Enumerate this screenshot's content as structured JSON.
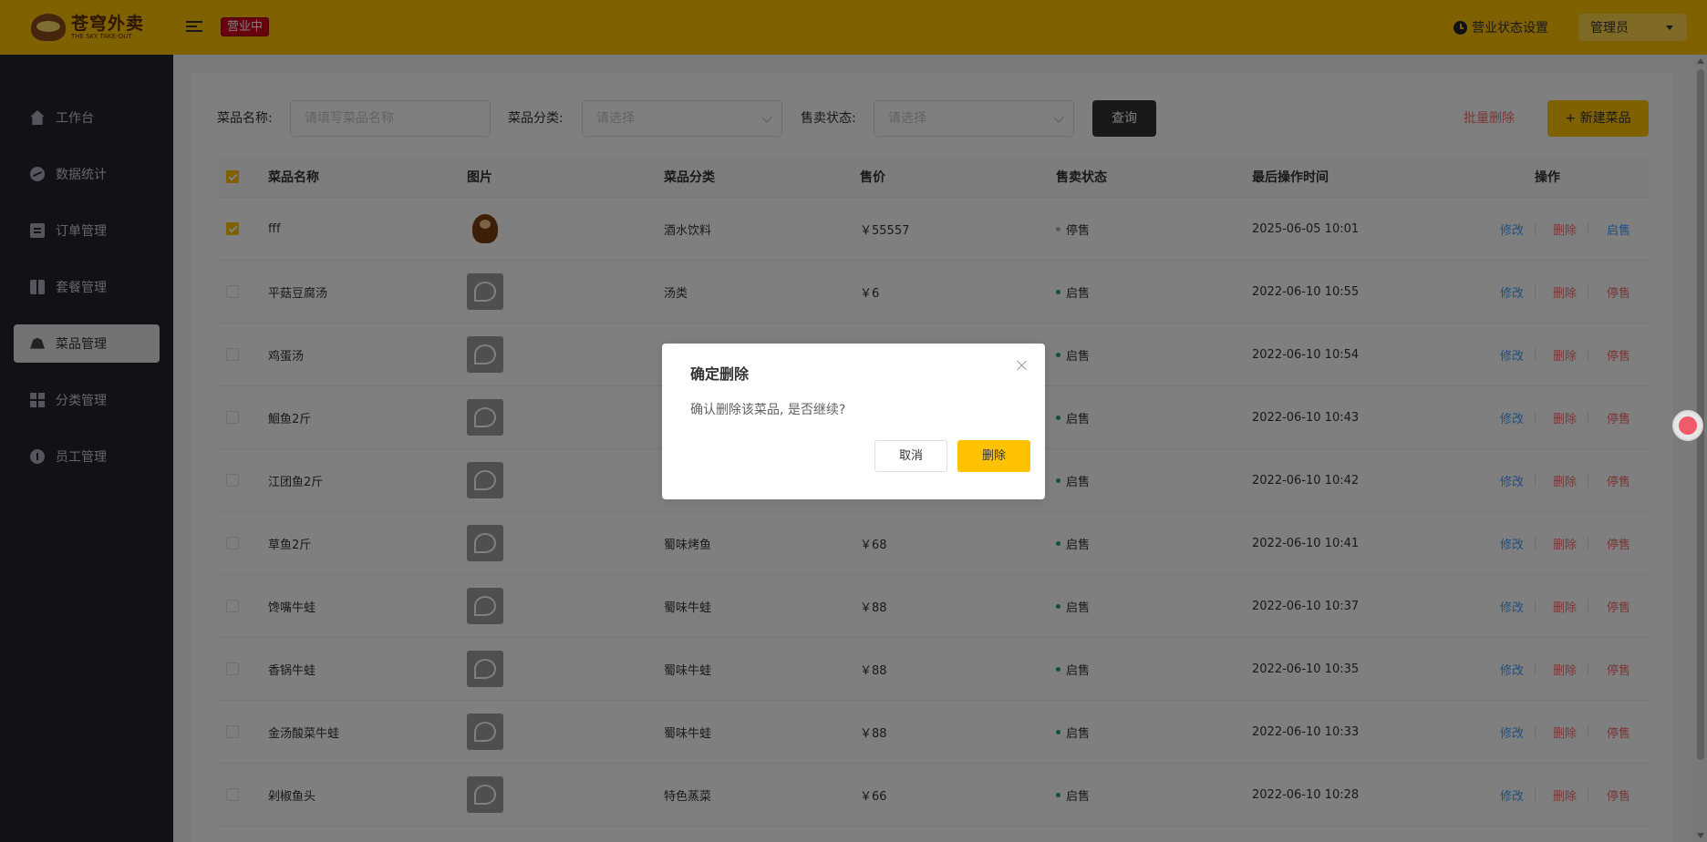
{
  "header": {
    "logo_cn": "苍穹外卖",
    "logo_en": "THE SKY TAKE-OUT",
    "status_tag": "营业中",
    "shop_setting_label": "营业状态设置",
    "admin_label": "管理员"
  },
  "sidebar": {
    "items": [
      {
        "label": "工作台",
        "icon": "home-icon"
      },
      {
        "label": "数据统计",
        "icon": "chart-icon"
      },
      {
        "label": "订单管理",
        "icon": "order-icon"
      },
      {
        "label": "套餐管理",
        "icon": "gift-icon"
      },
      {
        "label": "菜品管理",
        "icon": "dish-icon",
        "active": true
      },
      {
        "label": "分类管理",
        "icon": "grid-icon"
      },
      {
        "label": "员工管理",
        "icon": "info-icon"
      }
    ]
  },
  "filters": {
    "name_label": "菜品名称:",
    "name_placeholder": "请填写菜品名称",
    "category_label": "菜品分类:",
    "category_placeholder": "请选择",
    "status_label": "售卖状态:",
    "status_placeholder": "请选择",
    "query_label": "查询",
    "batch_delete_label": "批量删除",
    "new_dish_label": "+ 新建菜品"
  },
  "table": {
    "headers": [
      "菜品名称",
      "图片",
      "菜品分类",
      "售价",
      "售卖状态",
      "最后操作时间",
      "操作"
    ],
    "rows": [
      {
        "name": "fff",
        "category": "酒水饮料",
        "price": "￥55557",
        "status": "停售",
        "time": "2025-06-05 10:01",
        "edit": "修改",
        "del": "删除",
        "toggle": "启售",
        "checked": true
      },
      {
        "name": "平菇豆腐汤",
        "category": "汤类",
        "price": "￥6",
        "status": "启售",
        "time": "2022-06-10 10:55",
        "edit": "修改",
        "del": "删除",
        "toggle": "停售",
        "checked": false
      },
      {
        "name": "鸡蛋汤",
        "category": "",
        "price": "",
        "status": "启售",
        "time": "2022-06-10 10:54",
        "edit": "修改",
        "del": "删除",
        "toggle": "停售",
        "checked": false
      },
      {
        "name": "鮰鱼2斤",
        "category": "",
        "price": "",
        "status": "启售",
        "time": "2022-06-10 10:43",
        "edit": "修改",
        "del": "删除",
        "toggle": "停售",
        "checked": false
      },
      {
        "name": "江团鱼2斤",
        "category": "",
        "price": "",
        "status": "启售",
        "time": "2022-06-10 10:42",
        "edit": "修改",
        "del": "删除",
        "toggle": "停售",
        "checked": false
      },
      {
        "name": "草鱼2斤",
        "category": "蜀味烤鱼",
        "price": "￥68",
        "status": "启售",
        "time": "2022-06-10 10:41",
        "edit": "修改",
        "del": "删除",
        "toggle": "停售",
        "checked": false
      },
      {
        "name": "馋嘴牛蛙",
        "category": "蜀味牛蛙",
        "price": "￥88",
        "status": "启售",
        "time": "2022-06-10 10:37",
        "edit": "修改",
        "del": "删除",
        "toggle": "停售",
        "checked": false
      },
      {
        "name": "香锅牛蛙",
        "category": "蜀味牛蛙",
        "price": "￥88",
        "status": "启售",
        "time": "2022-06-10 10:35",
        "edit": "修改",
        "del": "删除",
        "toggle": "停售",
        "checked": false
      },
      {
        "name": "金汤酸菜牛蛙",
        "category": "蜀味牛蛙",
        "price": "￥88",
        "status": "启售",
        "time": "2022-06-10 10:33",
        "edit": "修改",
        "del": "删除",
        "toggle": "停售",
        "checked": false
      },
      {
        "name": "剁椒鱼头",
        "category": "特色蒸菜",
        "price": "￥66",
        "status": "启售",
        "time": "2022-06-10 10:28",
        "edit": "修改",
        "del": "删除",
        "toggle": "停售",
        "checked": false
      }
    ]
  },
  "dialog": {
    "title": "确定删除",
    "message": "确认删除该菜品, 是否继续?",
    "cancel_label": "取消",
    "confirm_label": "删除"
  },
  "colors": {
    "brand": "#ffc200",
    "sidebar_bg": "#22252d",
    "danger": "#f56c6c",
    "link": "#419eff",
    "on_sale_dot": "#20a36a",
    "off_sale_dot": "#b0b0b0"
  }
}
